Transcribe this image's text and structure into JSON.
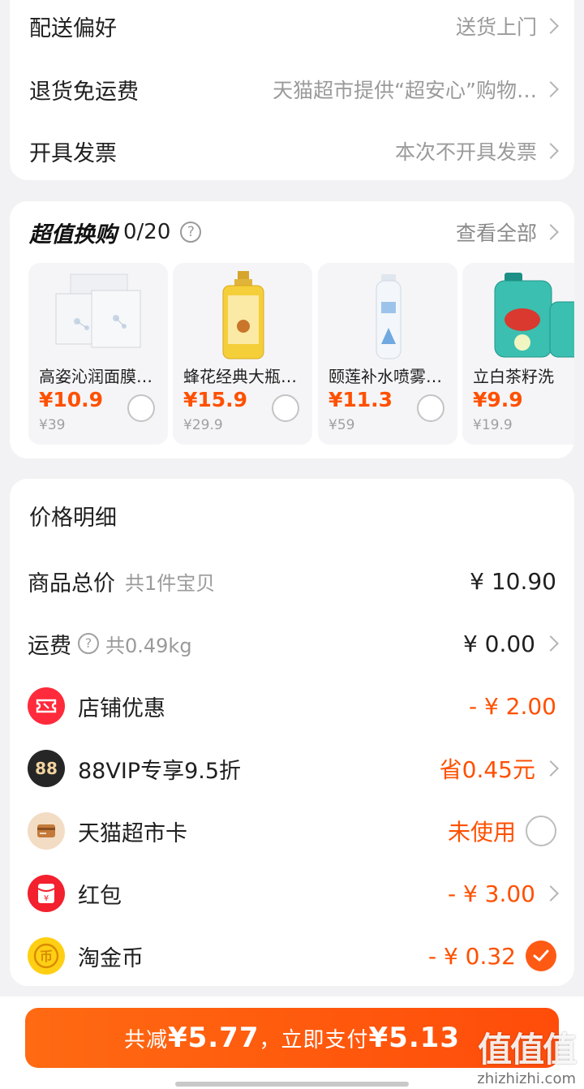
{
  "settings": [
    {
      "label": "配送偏好",
      "value": "送货上门"
    },
    {
      "label": "退货免运费",
      "value": "天猫超市提供“超安心”购物…"
    },
    {
      "label": "开具发票",
      "value": "本次不开具发票"
    }
  ],
  "swap": {
    "title": "超值换购",
    "count": "0/20",
    "help_icon": "?",
    "see_all": "查看全部",
    "products": [
      {
        "name": "高姿沁润面膜…",
        "price": "¥10.9",
        "orig": "¥39",
        "icon": "face-mask-box-image"
      },
      {
        "name": "蜂花经典大瓶…",
        "price": "¥15.9",
        "orig": "¥29.9",
        "icon": "shampoo-bottle-image"
      },
      {
        "name": "颐莲补水喷雾…",
        "price": "¥11.3",
        "orig": "¥59",
        "icon": "spray-bottle-image"
      },
      {
        "name": "立白茶籽洗",
        "price": "¥9.9",
        "orig": "¥19.9",
        "icon": "detergent-bottle-image"
      }
    ]
  },
  "price": {
    "title": "价格明细",
    "rows": [
      {
        "label": "商品总价",
        "sub": "共1件宝贝",
        "value": "¥ 10.90"
      },
      {
        "label": "运费",
        "sub": "共0.49kg",
        "value": "¥ 0.00"
      },
      {
        "label": "店铺优惠",
        "value": "- ¥ 2.00"
      },
      {
        "label": "88VIP专享9.5折",
        "value": "省0.45元",
        "badge_text": "88"
      },
      {
        "label": "天猫超市卡",
        "value": "未使用"
      },
      {
        "label": "红包",
        "value": "- ¥ 3.00",
        "badge_text": "¥"
      },
      {
        "label": "淘金币",
        "value": "- ¥ 0.32",
        "badge_text": "币"
      }
    ]
  },
  "pay": {
    "prefix": "共减",
    "saved": "¥5.77",
    "mid": "，立即支付",
    "total": "¥5.13"
  },
  "watermark": {
    "logo": "值值值",
    "url": "zhizhizhi.com"
  },
  "colors": {
    "accent": "#ff5000",
    "button": "#ff5a14",
    "background": "#f2f2f4"
  }
}
